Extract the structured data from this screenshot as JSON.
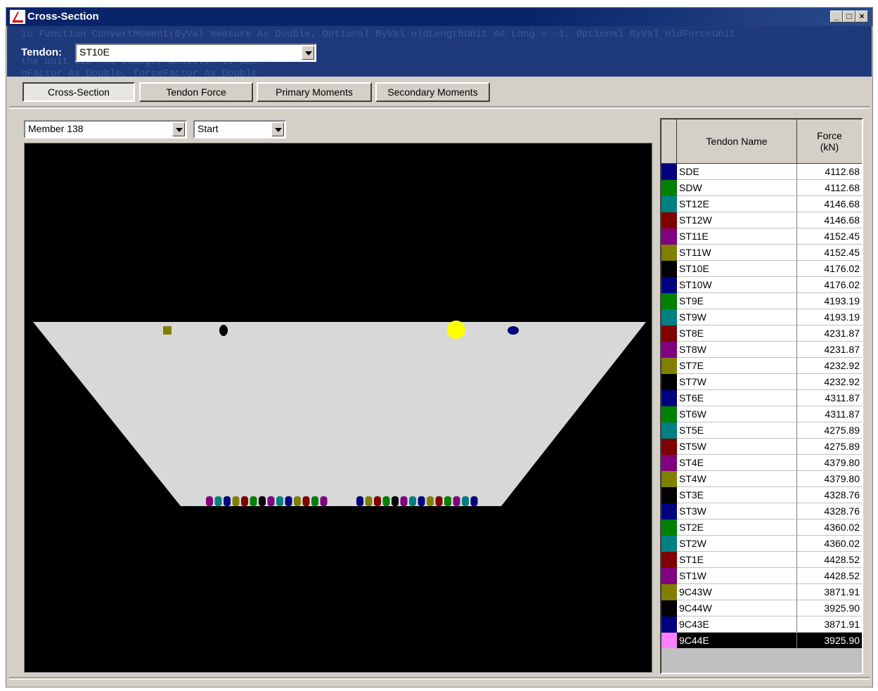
{
  "window": {
    "title": "Cross-Section",
    "controls": {
      "minimize": "_",
      "maximize": "□",
      "close": "×"
    }
  },
  "header": {
    "background_code": [
      "ic Function ConvertMoment(ByVal measure As Double, Optional ByVal oldLengthUnit As Long = -1, Optional ByVal oldForceUnit",
      "                                         the unit did not change, whatever it was.",
      "       nFactor As Double, forceFactor As Double"
    ],
    "tendon_label": "Tendon:",
    "tendon_value": "ST10E"
  },
  "tabs": [
    {
      "label": "Cross-Section",
      "active": true
    },
    {
      "label": "Tendon Force",
      "active": false
    },
    {
      "label": "Primary Moments",
      "active": false
    },
    {
      "label": "Secondary Moments",
      "active": false
    }
  ],
  "member_select": {
    "value": "Member 138"
  },
  "position_select": {
    "value": "Start"
  },
  "grid": {
    "col_name": "Tendon Name",
    "col_force": "Force\n(kN)",
    "rows": [
      {
        "name": "SDE",
        "force": "4112.68",
        "color": "#000080"
      },
      {
        "name": "SDW",
        "force": "4112.68",
        "color": "#008000"
      },
      {
        "name": "ST12E",
        "force": "4146.68",
        "color": "#008080"
      },
      {
        "name": "ST12W",
        "force": "4146.68",
        "color": "#800000"
      },
      {
        "name": "ST11E",
        "force": "4152.45",
        "color": "#800080"
      },
      {
        "name": "ST11W",
        "force": "4152.45",
        "color": "#808000"
      },
      {
        "name": "ST10E",
        "force": "4176.02",
        "color": "#000000"
      },
      {
        "name": "ST10W",
        "force": "4176.02",
        "color": "#000080"
      },
      {
        "name": "ST9E",
        "force": "4193.19",
        "color": "#008000"
      },
      {
        "name": "ST9W",
        "force": "4193.19",
        "color": "#008080"
      },
      {
        "name": "ST8E",
        "force": "4231.87",
        "color": "#800000"
      },
      {
        "name": "ST8W",
        "force": "4231.87",
        "color": "#800080"
      },
      {
        "name": "ST7E",
        "force": "4232.92",
        "color": "#808000"
      },
      {
        "name": "ST7W",
        "force": "4232.92",
        "color": "#000000"
      },
      {
        "name": "ST6E",
        "force": "4311.87",
        "color": "#000080"
      },
      {
        "name": "ST6W",
        "force": "4311.87",
        "color": "#008000"
      },
      {
        "name": "ST5E",
        "force": "4275.89",
        "color": "#008080"
      },
      {
        "name": "ST5W",
        "force": "4275.89",
        "color": "#800000"
      },
      {
        "name": "ST4E",
        "force": "4379.80",
        "color": "#800080"
      },
      {
        "name": "ST4W",
        "force": "4379.80",
        "color": "#808000"
      },
      {
        "name": "ST3E",
        "force": "4328.76",
        "color": "#000000"
      },
      {
        "name": "ST3W",
        "force": "4328.76",
        "color": "#000080"
      },
      {
        "name": "ST2E",
        "force": "4360.02",
        "color": "#008000"
      },
      {
        "name": "ST2W",
        "force": "4360.02",
        "color": "#008080"
      },
      {
        "name": "ST1E",
        "force": "4428.52",
        "color": "#800000"
      },
      {
        "name": "ST1W",
        "force": "4428.52",
        "color": "#800080"
      },
      {
        "name": "9C43W",
        "force": "3871.91",
        "color": "#808000"
      },
      {
        "name": "9C44W",
        "force": "3925.90",
        "color": "#000000"
      },
      {
        "name": "9C43E",
        "force": "3871.91",
        "color": "#000080"
      },
      {
        "name": "9C44E",
        "force": "3925.90",
        "color": "#ff80ff",
        "selected": true
      }
    ]
  },
  "colors": {
    "section_fill": "#d8d8d8",
    "highlight_tendon": "#ffff00",
    "canvas_bg": "#000000",
    "title_bg": "#0a246a"
  }
}
